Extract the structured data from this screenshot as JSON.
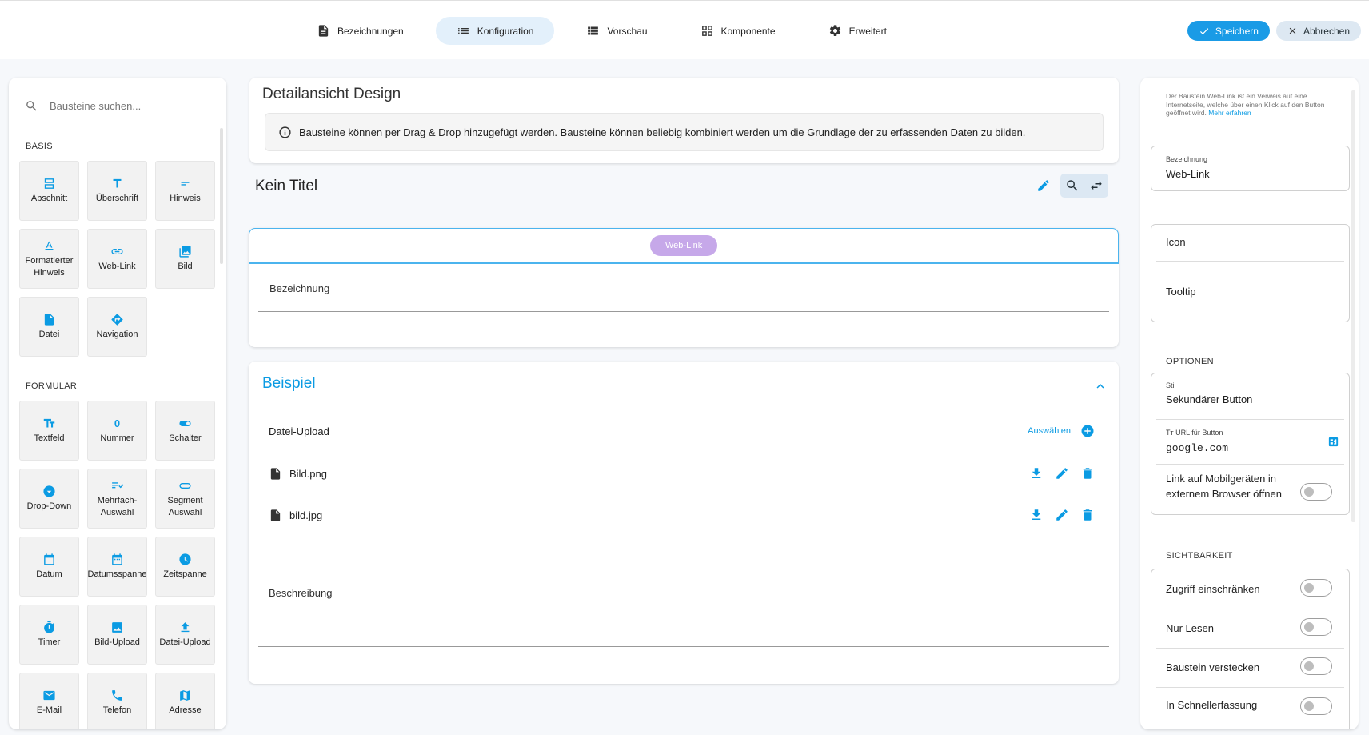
{
  "tabs": [
    {
      "label": "Bezeichnungen",
      "icon": "document-icon"
    },
    {
      "label": "Konfiguration",
      "icon": "list-icon"
    },
    {
      "label": "Vorschau",
      "icon": "table-list-icon"
    },
    {
      "label": "Komponente",
      "icon": "grid-icon"
    },
    {
      "label": "Erweitert",
      "icon": "gear-icon"
    }
  ],
  "active_tab": "Konfiguration",
  "actions": {
    "save": "Speichern",
    "cancel": "Abbrechen"
  },
  "colors": {
    "accent": "#0b9be3",
    "primary_button": "#1a9be6",
    "chip": "#c6a8e9",
    "active_tab_bg": "#e3f0fb"
  },
  "palette": {
    "search_placeholder": "Bausteine suchen...",
    "basis_title": "BASIS",
    "basis": [
      {
        "label": "Abschnitt",
        "icon": "section-icon"
      },
      {
        "label": "Überschrift",
        "icon": "heading-icon"
      },
      {
        "label": "Hinweis",
        "icon": "note-icon"
      },
      {
        "label": "Formatierter Hinweis",
        "icon": "format-text-icon"
      },
      {
        "label": "Web-Link",
        "icon": "link-icon"
      },
      {
        "label": "Bild",
        "icon": "image-icon"
      },
      {
        "label": "Datei",
        "icon": "file-icon"
      },
      {
        "label": "Navigation",
        "icon": "navigation-icon"
      }
    ],
    "formular_title": "FORMULAR",
    "formular": [
      {
        "label": "Textfeld",
        "icon": "textfield-icon"
      },
      {
        "label": "Nummer",
        "icon": "number-icon",
        "glyph": "0"
      },
      {
        "label": "Schalter",
        "icon": "switch-icon"
      },
      {
        "label": "Drop-Down",
        "icon": "dropdown-icon"
      },
      {
        "label": "Mehrfach-Auswahl",
        "icon": "multiselect-icon"
      },
      {
        "label": "Segment Auswahl",
        "icon": "segment-icon"
      },
      {
        "label": "Datum",
        "icon": "calendar-icon"
      },
      {
        "label": "Datumsspanne",
        "icon": "date-range-icon"
      },
      {
        "label": "Zeitspanne",
        "icon": "clock-icon"
      },
      {
        "label": "Timer",
        "icon": "timer-icon"
      },
      {
        "label": "Bild-Upload",
        "icon": "image-upload-icon"
      },
      {
        "label": "Datei-Upload",
        "icon": "upload-icon"
      },
      {
        "label": "E-Mail",
        "icon": "mail-icon"
      },
      {
        "label": "Telefon",
        "icon": "phone-icon"
      },
      {
        "label": "Adresse",
        "icon": "map-icon"
      }
    ]
  },
  "design": {
    "title": "Detailansicht Design",
    "info": "Bausteine können per Drag & Drop hinzugefügt werden. Bausteine können beliebig kombiniert werden um die Grundlage der zu erfassenden Daten zu bilden.",
    "page_title": "Kein Titel"
  },
  "weblink_block": {
    "chip": "Web-Link",
    "field_label": "Bezeichnung"
  },
  "beispiel": {
    "title": "Beispiel",
    "upload_label": "Datei-Upload",
    "select_label": "Auswählen",
    "files": [
      "Bild.png",
      "bild.jpg"
    ],
    "description_label": "Beschreibung"
  },
  "properties": {
    "help_text": "Der Baustein Web-Link ist ein Verweis auf eine Internetseite, welche über einen Klick auf den Button geöffnet wird.",
    "help_link": "Mehr erfahren",
    "name_label": "Bezeichnung",
    "name_value": "Web-Link",
    "icon_label": "Icon",
    "tooltip_label": "Tooltip",
    "options_title": "OPTIONEN",
    "style_label": "Stil",
    "style_value": "Sekundärer Button",
    "url_label": "URL für Button",
    "url_prefix": "Tт",
    "url_value": "google.com",
    "external_label": "Link auf Mobilgeräten in externem Browser öffnen",
    "visibility_title": "SICHTBARKEIT",
    "visibility": [
      {
        "label": "Zugriff einschränken",
        "on": false
      },
      {
        "label": "Nur Lesen",
        "on": false
      },
      {
        "label": "Baustein verstecken",
        "on": false
      },
      {
        "label": "In Schnellerfassung",
        "on": false
      }
    ]
  }
}
